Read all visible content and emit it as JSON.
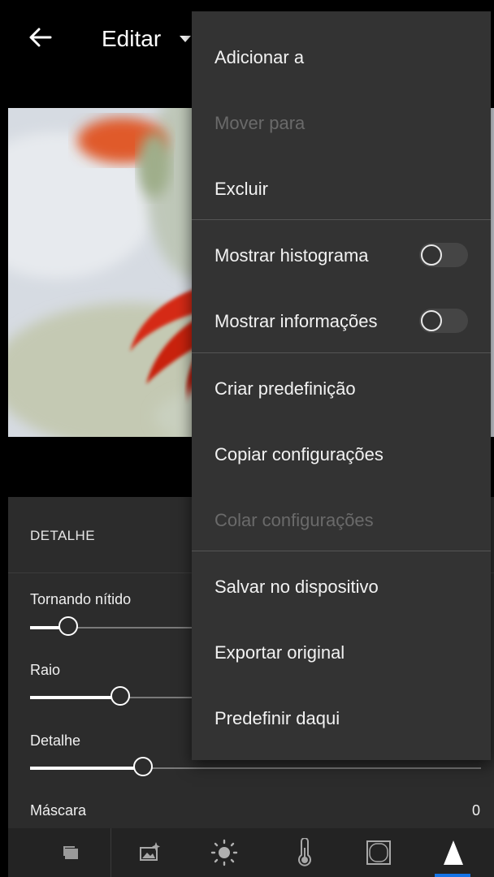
{
  "header": {
    "title": "Editar"
  },
  "panel": {
    "title": "DETALHE",
    "sliders": [
      {
        "label": "Tornando nítido",
        "value": "",
        "level": 0.085
      },
      {
        "label": "Raio",
        "value": "",
        "level": 0.2
      },
      {
        "label": "Detalhe",
        "value": "",
        "level": 0.25
      },
      {
        "label": "Máscara",
        "value": "0"
      }
    ]
  },
  "menu": {
    "items": [
      {
        "label": "Adicionar a",
        "enabled": true
      },
      {
        "label": "Mover para",
        "enabled": false
      },
      {
        "label": "Excluir",
        "enabled": true
      },
      {
        "label": "Mostrar histograma",
        "enabled": true,
        "toggle": false
      },
      {
        "label": "Mostrar informações",
        "enabled": true,
        "toggle": false
      },
      {
        "label": "Criar predefinição",
        "enabled": true
      },
      {
        "label": "Copiar configurações",
        "enabled": true
      },
      {
        "label": "Colar configurações",
        "enabled": false
      },
      {
        "label": "Salvar no dispositivo",
        "enabled": true
      },
      {
        "label": "Exportar original",
        "enabled": true
      },
      {
        "label": "Predefinir daqui",
        "enabled": true
      }
    ]
  },
  "toolbar": {
    "icons": [
      "presets-icon",
      "auto-enhance-icon",
      "light-icon",
      "color-temperature-icon",
      "effects-vignette-icon",
      "detail-icon"
    ],
    "active": "detail-icon",
    "accent_color": "#1473e6"
  }
}
